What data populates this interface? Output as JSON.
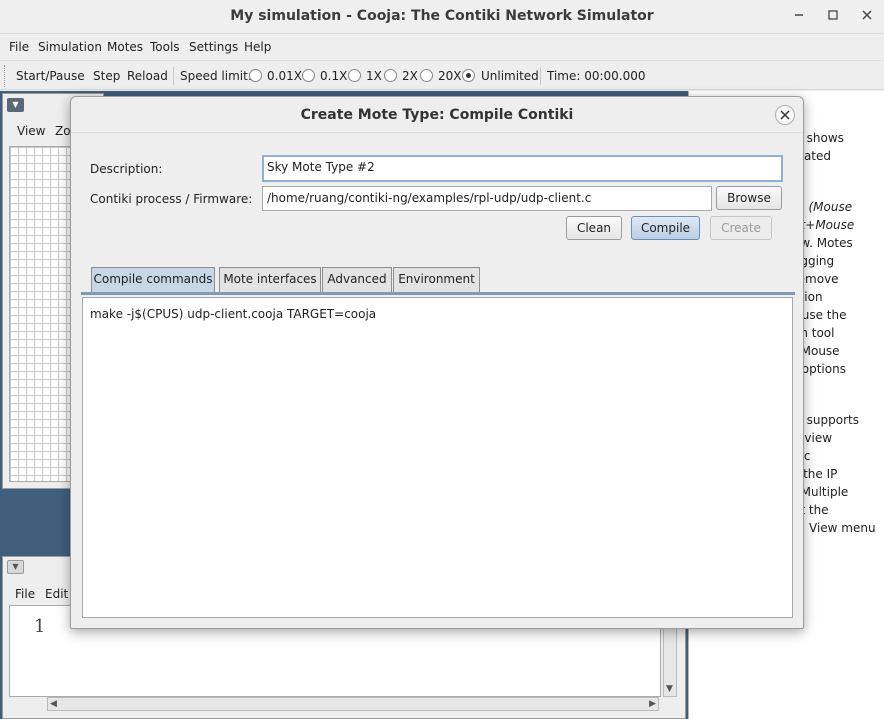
{
  "window": {
    "title": "My simulation - Cooja: The Contiki Network Simulator",
    "controls": {
      "minimize": "✕",
      "maximize": "☐",
      "close": "✕"
    }
  },
  "menubar": [
    "File",
    "Simulation",
    "Motes",
    "Tools",
    "Settings",
    "Help"
  ],
  "toolbar": {
    "start_pause": "Start/Pause",
    "step": "Step",
    "reload": "Reload",
    "speed_label": "Speed limit:",
    "speeds": [
      "0.01X",
      "0.1X",
      "1X",
      "2X",
      "20X",
      "Unlimited"
    ],
    "selected_speed": "Unlimited",
    "time": "Time: 00:00.000"
  },
  "network_panel": {
    "menu": [
      "View",
      "Zoo"
    ]
  },
  "editor_panel": {
    "menu": [
      "File",
      "Edit"
    ],
    "line_number": "1"
  },
  "notes_panel": {
    "lines": [
      {
        "text": "w shows",
        "italic": false
      },
      {
        "text": "ulated",
        "italic": false
      },
      {
        "text": "m (Mouse",
        "italic": true
      },
      {
        "text": "ift+Mouse",
        "italic": true
      },
      {
        "text": "ew. Motes",
        "italic": false
      },
      {
        "text": "agging",
        "italic": false
      },
      {
        "text": "remove",
        "italic": false
      },
      {
        "text": "ction",
        "italic": false
      },
      {
        "text": "r use the",
        "italic": false
      },
      {
        "text": "on tool",
        "italic": false
      },
      {
        "text": ". Mouse",
        "italic": false
      },
      {
        "text": "r options",
        "italic": false
      },
      {
        "text": "w supports",
        "italic": false
      },
      {
        "text": "h view",
        "italic": false
      },
      {
        "text": "ific",
        "italic": false
      },
      {
        "text": "s the IP",
        "italic": false
      },
      {
        "text": ". Multiple",
        "italic": false
      },
      {
        "text": "at the",
        "italic": false
      },
      {
        "text": "View menu",
        "italic": false
      }
    ]
  },
  "dialog": {
    "title": "Create Mote Type: Compile Contiki",
    "close": "✕",
    "description_label": "Description:",
    "description_value": "Sky Mote Type #2",
    "firmware_label": "Contiki process / Firmware:",
    "firmware_value": "/home/ruang/contiki-ng/examples/rpl-udp/udp-client.c",
    "browse": "Browse",
    "clean": "Clean",
    "compile": "Compile",
    "create": "Create",
    "tabs": [
      "Compile commands",
      "Mote interfaces",
      "Advanced",
      "Environment"
    ],
    "active_tab": "Compile commands",
    "compile_command": "make -j$(CPUS) udp-client.cooja TARGET=cooja"
  }
}
